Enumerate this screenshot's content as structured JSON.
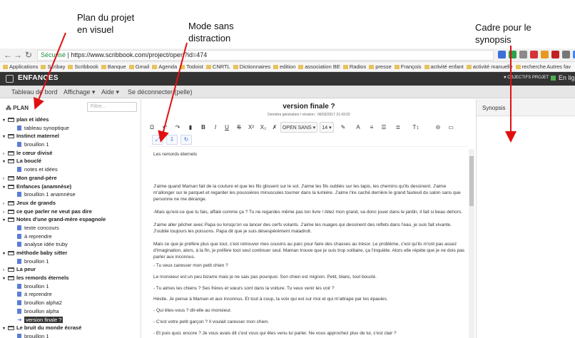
{
  "annotations": {
    "plan": [
      "Plan du projet",
      "en visuel"
    ],
    "mode": [
      "Mode sans",
      "distraction"
    ],
    "cadre": [
      "Cadre pour le",
      "synopsis"
    ]
  },
  "browser": {
    "url_secure": "Sécurisé",
    "url_text": "https://www.scribbook.com/project/open?id=474",
    "bookmarks": [
      "Applications",
      "Scribay",
      "Scribbook",
      "Banque",
      "Gmail",
      "Agenda",
      "Todoist",
      "CNRTL",
      "Dictionnaires",
      "edition",
      "association BE",
      "Radios",
      "presse",
      "François",
      "activité enfant",
      "activité manuelle",
      "recherche"
    ],
    "bookmarks_right": "Autres fav"
  },
  "app": {
    "title": "ENFANCES",
    "objectifs": "♥ OBJECTIFS PROJET",
    "right_label": "En lig"
  },
  "menu": {
    "tableau": "Tableau de bord",
    "affichage": "Affichage ▾",
    "aide": "Aide ▾",
    "deconnecter": "Se déconnecter (pelle)"
  },
  "sidebar": {
    "heading": "PLAN",
    "filter_placeholder": "Filtre...",
    "tree": [
      {
        "label": "plan et idées",
        "level": 0,
        "kind": "folder",
        "open": true
      },
      {
        "label": "tableau synoptique",
        "level": 1,
        "kind": "doc"
      },
      {
        "label": "Instinct maternel",
        "level": 0,
        "kind": "folder",
        "open": true
      },
      {
        "label": "brouillon 1",
        "level": 1,
        "kind": "doc"
      },
      {
        "label": "le cœur divisé",
        "level": 0,
        "kind": "folder",
        "open": false
      },
      {
        "label": "La bouclé",
        "level": 0,
        "kind": "folder",
        "open": true
      },
      {
        "label": "notes et idées",
        "level": 1,
        "kind": "doc"
      },
      {
        "label": "Mon grand-père",
        "level": 0,
        "kind": "folder",
        "open": false
      },
      {
        "label": "Enfances (anamnèse)",
        "level": 0,
        "kind": "folder",
        "open": true
      },
      {
        "label": "brouillon 1 anamnèse",
        "level": 1,
        "kind": "doc"
      },
      {
        "label": "Jeux de grands",
        "level": 0,
        "kind": "folder",
        "open": false
      },
      {
        "label": "ce que parler ne veut pas dire",
        "level": 0,
        "kind": "folder",
        "open": false
      },
      {
        "label": "Notes d'une grand-mère espagnole",
        "level": 0,
        "kind": "folder",
        "open": true
      },
      {
        "label": "texte concours",
        "level": 1,
        "kind": "doc"
      },
      {
        "label": "à reprendre",
        "level": 1,
        "kind": "doc"
      },
      {
        "label": "analyse idée truby",
        "level": 1,
        "kind": "doc"
      },
      {
        "label": "méthode baby sitter",
        "level": 0,
        "kind": "folder",
        "open": true
      },
      {
        "label": "brouillon 1",
        "level": 1,
        "kind": "doc"
      },
      {
        "label": "La peur",
        "level": 0,
        "kind": "folder",
        "open": false
      },
      {
        "label": "les remords éternels",
        "level": 0,
        "kind": "folder",
        "open": true
      },
      {
        "label": "brouillon 1",
        "level": 1,
        "kind": "doc"
      },
      {
        "label": "à reprendre",
        "level": 1,
        "kind": "doc"
      },
      {
        "label": "brouillon alpha2",
        "level": 1,
        "kind": "doc"
      },
      {
        "label": "brouillon alpha",
        "level": 1,
        "kind": "doc"
      },
      {
        "label": "version finale ?",
        "level": 1,
        "kind": "current",
        "active": true
      },
      {
        "label": "Le bruit du monde écrasé",
        "level": 0,
        "kind": "folder",
        "open": true
      },
      {
        "label": "brouillon 1",
        "level": 1,
        "kind": "doc"
      }
    ]
  },
  "editor": {
    "title": "version finale ?",
    "subtitle": "Dernière génération / révision : 06/03/2017 21:43:02",
    "font_select": "OPEN SANS ▾",
    "size_select": "14 ▾",
    "doc_heading": "Les remords éternels",
    "paragraphs": [
      "J'aime quand Maman fait de la couture et que les fils glissent sur le sol. J'aime les fils oubliés sur les tapis, les chemins qu'ils dessinent. J'aime m'allonger sur le parquet et regarder les poussières minuscules tourner dans la lumière. J'aime l'ire caché derrière le grand fauteuil du salon sans que personne ne me dérange.",
      "-Mais qu'est-ce que tu fais, affalé comme ça ? Tu ne regardes même pas ton livre ! Allez mon grand, va donc jouer dans le jardin, il fait si beau dehors.",
      "J'aime aller pêcher avec Papa ou lorsqu'on va lancer des cerfs volants. J'aime les nuages qui dessinent des reflets dans l'eau, je suis fait vivante. J'oublie toujours les poissons. Papa dit que je suis désespérément maladroit.",
      "Mais ce que je préfère plus que tout, c'est retrouver mes cousins au parc pour faire des chasses au trésor. Le problème, c'est qu'ils m'ont pas assez d'imagination, alors, à la fin, je préfère tout seul continuer seul. Maman trouve que je suis trop solitaire, ça l'inquiète. Alors elle répète que je ne dois pas parler aux inconnus.",
      "- Tu veux caresser mon petit chien ?",
      "Le monsieur est un peu bizarre mais je ne sais pas pourquoi. Son chien est mignon. Petit, blanc, tout bouclé.",
      "- Tu aimes les chiens ? Ses frères et sœurs sont dans la voiture. Tu veux venir les voir ?",
      "Hésite. Je pense à Maman et aux inconnus. Et tout à coup, la voix qui est sur moi et qui m'attrape par les épaules.",
      "- Qui êtes-vous ? dit-elle au monsieur.",
      "- C'est votre petit garçon ? Il voulait caresser mon chien.",
      "- Et puis quoi, encore ? Je vous avais dit c'est vous qui êtes venu lui parler. Ne vous approchez plus de lui, c'est clair ?"
    ]
  },
  "synopsis": {
    "title": "Synopsis"
  },
  "colors": {
    "header_bg": "#333333",
    "menu_bg": "#e6e6e6",
    "annotation_arrow": "#e01010",
    "doc_icon": "#5a7ed6"
  }
}
